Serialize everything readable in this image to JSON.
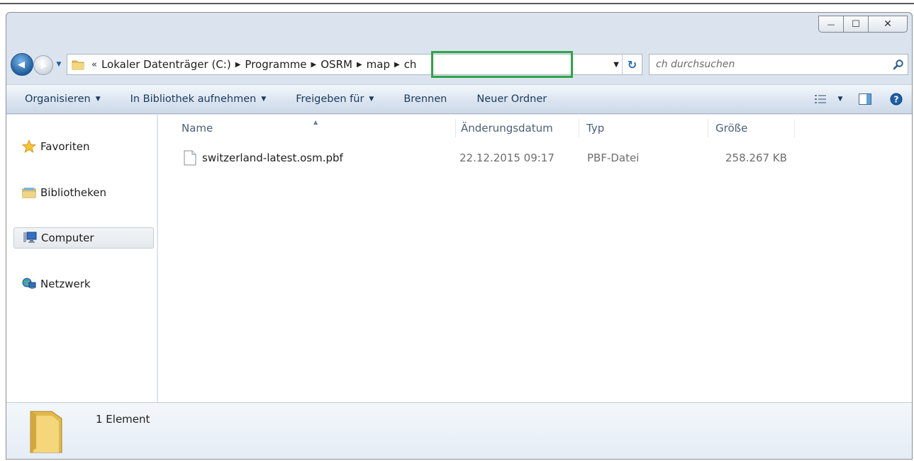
{
  "window": {
    "caption": {
      "minimize_glyph": "—",
      "maximize_glyph": "☐",
      "close_glyph": "✕"
    }
  },
  "nav": {
    "back_glyph": "◀",
    "forward_glyph": "▶",
    "history_glyph": "▼"
  },
  "addressbar": {
    "overflow_glyph": "«",
    "breadcrumbs": [
      {
        "label": "Lokaler Datenträger (C:)"
      },
      {
        "label": "Programme"
      },
      {
        "label": "OSRM"
      },
      {
        "label": "map"
      },
      {
        "label": "ch"
      }
    ],
    "separator_glyph": "▶",
    "dropdown_glyph": "▼",
    "refresh_glyph": "↻"
  },
  "search": {
    "placeholder": "ch durchsuchen"
  },
  "toolbar": {
    "items": [
      {
        "label": "Organisieren",
        "has_dropdown": true
      },
      {
        "label": "In Bibliothek aufnehmen",
        "has_dropdown": true
      },
      {
        "label": "Freigeben für",
        "has_dropdown": true
      },
      {
        "label": "Brennen",
        "has_dropdown": false
      },
      {
        "label": "Neuer Ordner",
        "has_dropdown": false
      }
    ],
    "dropdown_glyph": "▼",
    "view_dropdown_glyph": "▼"
  },
  "sidebar": {
    "items": [
      {
        "label": "Favoriten",
        "icon": "star-icon",
        "selected": false
      },
      {
        "label": "Bibliotheken",
        "icon": "library-icon",
        "selected": false
      },
      {
        "label": "Computer",
        "icon": "computer-icon",
        "selected": true
      },
      {
        "label": "Netzwerk",
        "icon": "network-icon",
        "selected": false
      }
    ]
  },
  "file_list": {
    "columns": [
      "Name",
      "Änderungsdatum",
      "Typ",
      "Größe"
    ],
    "sort_glyph": "▲",
    "rows": [
      {
        "name": "switzerland-latest.osm.pbf",
        "modified": "22.12.2015 09:17",
        "type": "PBF-Datei",
        "size": "258.267 KB"
      }
    ]
  },
  "details": {
    "item_count": "1 Element"
  },
  "colors": {
    "accent_highlight": "#2fa447",
    "toolbar_text": "#1e395b",
    "column_header": "#4c607a"
  }
}
